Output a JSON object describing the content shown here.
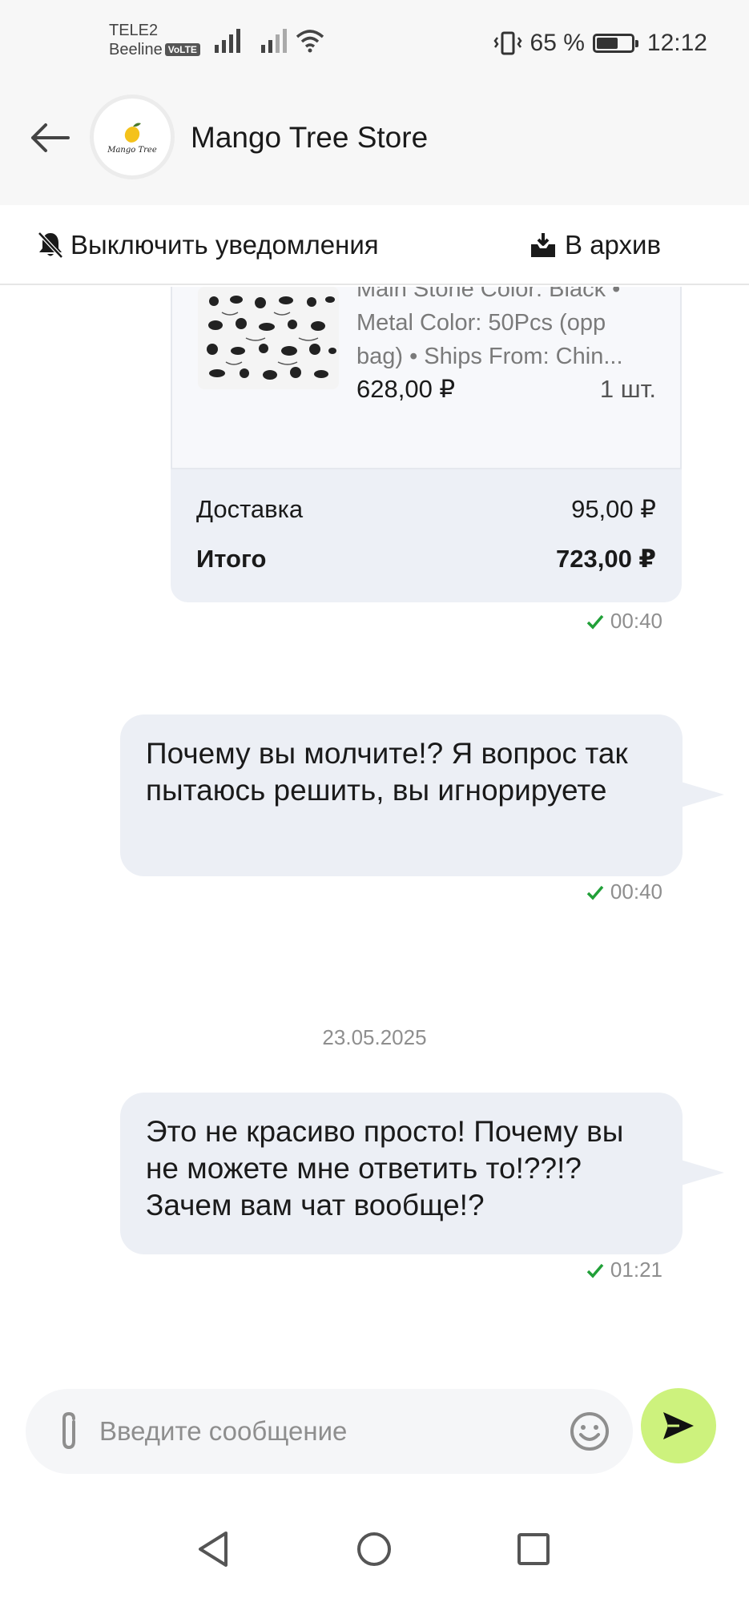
{
  "status_bar": {
    "carrier_1": "TELE2",
    "carrier_2": "Beeline",
    "volte": "VoLTE",
    "battery_percent": "65 %",
    "battery_level": 0.65,
    "time": "12:12"
  },
  "header": {
    "store_name": "Mango Tree Store",
    "avatar_logo_text": "Mango Tree"
  },
  "actions": {
    "mute_label": "Выключить уведомления",
    "archive_label": "В архив"
  },
  "order": {
    "item": {
      "attr_1": "Main Stone Color: Black •",
      "attr_2": "Metal Color: 50Pcs (opp",
      "attr_3": "bag) • Ships From: Chin...",
      "price": "628,00 ₽",
      "qty": "1 шт."
    },
    "delivery_label": "Доставка",
    "delivery_value": "95,00 ₽",
    "total_label": "Итого",
    "total_value": "723,00 ₽",
    "time": "00:40"
  },
  "messages": [
    {
      "text": "Почему вы молчите!? Я вопрос так пытаюсь решить, вы игнорируете",
      "time": "00:40"
    },
    {
      "text": "Это не красиво просто! Почему вы не можете мне ответить то!??!? Зачем вам чат вообще!?",
      "time": "01:21"
    }
  ],
  "date_separator": "23.05.2025",
  "composer": {
    "placeholder": "Введите сообщение"
  },
  "colors": {
    "accent_send": "#cdf27d",
    "check_green": "#21a038",
    "bubble": "#eceff5"
  }
}
